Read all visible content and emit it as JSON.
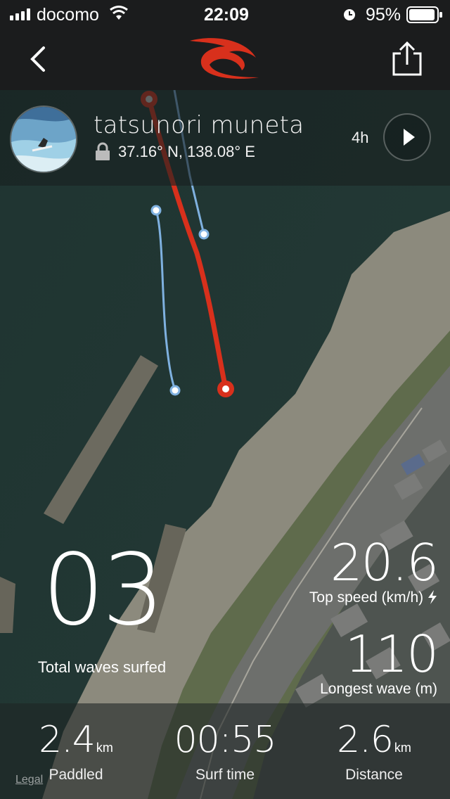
{
  "status_bar": {
    "carrier": "docomo",
    "time": "22:09",
    "battery": "95%"
  },
  "navbar": {
    "back_icon": "chevron-left-icon",
    "logo_icon": "rip-curl-wave-logo",
    "share_icon": "share-icon"
  },
  "profile": {
    "name": "tatsunori muneta",
    "location": "37.16° N, 138.08° E",
    "duration": "4h"
  },
  "stats": {
    "waves_value": "03",
    "waves_label": "Total waves surfed",
    "top_speed_value": "20.6",
    "top_speed_label": "Top speed (km/h)",
    "longest_wave_value": "110",
    "longest_wave_label": "Longest wave (m)"
  },
  "bottom": {
    "paddled_value": "2.4",
    "paddled_unit": "km",
    "paddled_label": "Paddled",
    "surf_time_value": "00:55",
    "surf_time_label": "Surf time",
    "distance_value": "2.6",
    "distance_unit": "km",
    "distance_label": "Distance",
    "legal": "Legal"
  },
  "colors": {
    "route_red": "#d8301c",
    "route_blue": "#7fb1e0",
    "bar_bg": "#1b1c1d"
  }
}
